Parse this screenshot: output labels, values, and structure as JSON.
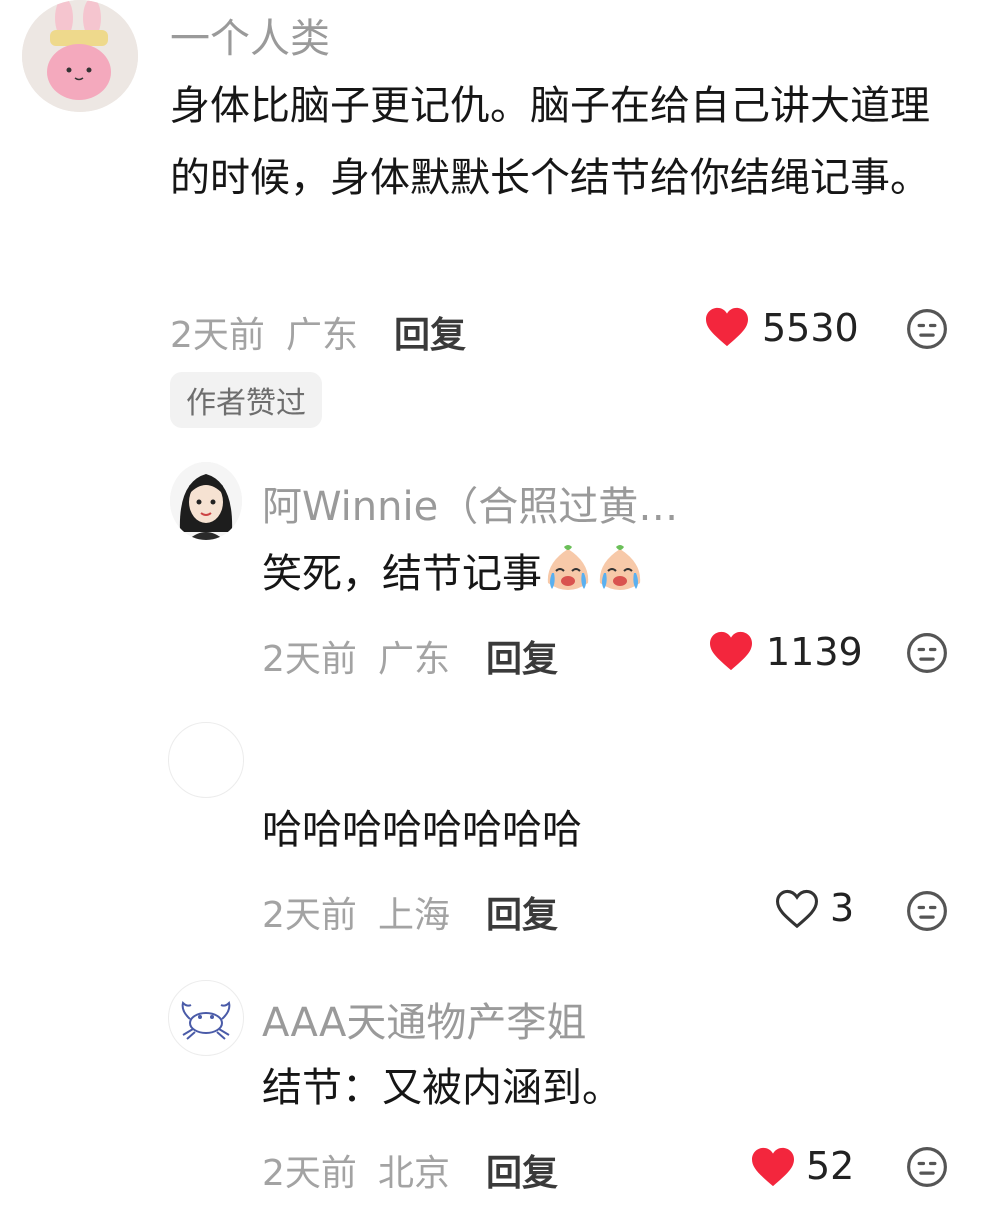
{
  "comments": [
    {
      "username": "一个人类",
      "content": "身体比脑子更记仇。脑子在给自己讲大道理的时候，身体默默长个结节给你结绳记事。",
      "time": "2天前",
      "location": "广东",
      "reply_label": "回复",
      "likes": "5530",
      "liked": true,
      "badge": "作者赞过",
      "avatar_icon": "pink-bunny-avatar"
    },
    {
      "username": "阿Winnie（合照过黄…",
      "content": "笑死，结节记事",
      "emoji": "crying-laughing-peach-emoji",
      "time": "2天前",
      "location": "广东",
      "reply_label": "回复",
      "likes": "1139",
      "liked": true,
      "avatar_icon": "cartoon-girl-avatar"
    },
    {
      "username": "",
      "content": "哈哈哈哈哈哈哈哈",
      "time": "2天前",
      "location": "上海",
      "reply_label": "回复",
      "likes": "3",
      "liked": false,
      "avatar_icon": "blank-avatar"
    },
    {
      "username": "AAA天通物产李姐",
      "content": "结节：又被内涵到。",
      "time": "2天前",
      "location": "北京",
      "reply_label": "回复",
      "likes": "52",
      "liked": true,
      "avatar_icon": "crab-avatar"
    }
  ],
  "colors": {
    "heart_red": "#f3263d",
    "meta_gray": "#a3a3a3",
    "username_gray": "#9a9a9a",
    "text": "#161616"
  }
}
